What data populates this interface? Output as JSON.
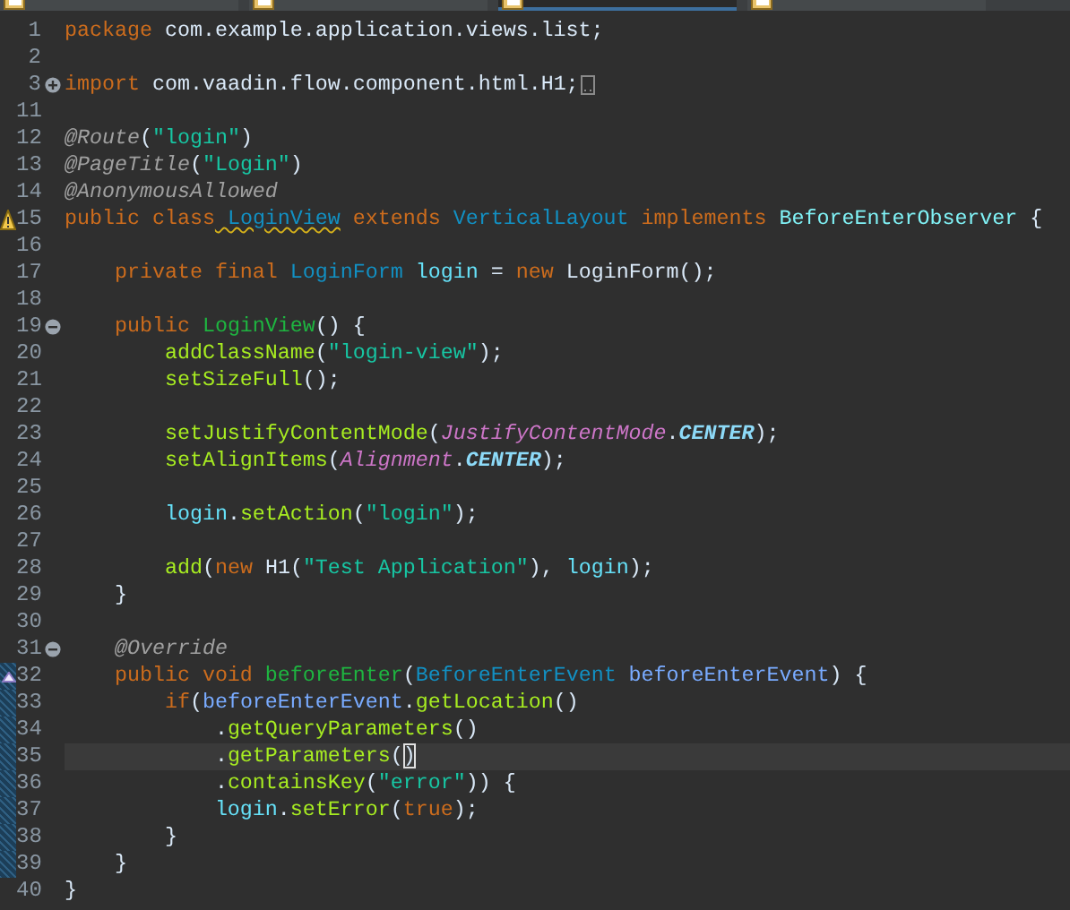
{
  "tabs": [
    {
      "selected": false
    },
    {
      "selected": false
    },
    {
      "selected": true
    },
    {
      "selected": false
    }
  ],
  "editor": {
    "lines": [
      {
        "number": "1",
        "changed": false,
        "current": false,
        "tokens": [
          {
            "kind": "keyword",
            "text": "package"
          },
          {
            "kind": "plain",
            "text": " com.example.application.views.list;"
          }
        ]
      },
      {
        "number": "2",
        "changed": false,
        "current": false
      },
      {
        "number": "3",
        "fold": {
          "expanded": false
        },
        "folded": true,
        "changed": false,
        "current": false,
        "tokens": [
          {
            "kind": "keyword",
            "text": "import"
          },
          {
            "kind": "plain",
            "text": " com.vaadin.flow.component.html.H1;"
          }
        ]
      },
      {
        "number": "11",
        "changed": false,
        "current": false
      },
      {
        "number": "12",
        "changed": false,
        "current": false,
        "tokens": [
          {
            "kind": "annotation",
            "text": "@Route"
          },
          {
            "kind": "plain",
            "text": "("
          },
          {
            "kind": "string",
            "text": "\"login\""
          },
          {
            "kind": "plain",
            "text": ")"
          }
        ]
      },
      {
        "number": "13",
        "changed": false,
        "current": false,
        "tokens": [
          {
            "kind": "annotation",
            "text": "@PageTitle"
          },
          {
            "kind": "plain",
            "text": "("
          },
          {
            "kind": "string",
            "text": "\"Login\""
          },
          {
            "kind": "plain",
            "text": ")"
          }
        ]
      },
      {
        "number": "14",
        "changed": false,
        "current": false,
        "tokens": [
          {
            "kind": "annotation",
            "text": "@AnonymousAllowed"
          }
        ]
      },
      {
        "number": "15",
        "marker": {
          "kind": "warning"
        },
        "changed": false,
        "current": false,
        "tokens": [
          {
            "kind": "keyword",
            "text": "public class"
          },
          {
            "kind": "type",
            "text": " LoginView",
            "warning": true
          },
          {
            "kind": "keyword",
            "text": " extends"
          },
          {
            "kind": "type",
            "text": " VerticalLayout"
          },
          {
            "kind": "keyword",
            "text": " implements"
          },
          {
            "kind": "interface",
            "text": " BeforeEnterObserver"
          },
          {
            "kind": "plain",
            "text": " {"
          }
        ]
      },
      {
        "number": "16",
        "changed": false,
        "current": false
      },
      {
        "number": "17",
        "changed": false,
        "current": false,
        "tokens": [
          {
            "kind": "keyword",
            "text": "    private final"
          },
          {
            "kind": "type",
            "text": " LoginForm"
          },
          {
            "kind": "field",
            "text": " login"
          },
          {
            "kind": "plain",
            "text": " ="
          },
          {
            "kind": "keyword",
            "text": " new"
          },
          {
            "kind": "plain",
            "text": " LoginForm();"
          }
        ]
      },
      {
        "number": "18",
        "changed": false,
        "current": false
      },
      {
        "number": "19",
        "fold": {
          "expanded": true
        },
        "changed": false,
        "current": false,
        "tokens": [
          {
            "kind": "keyword",
            "text": "    public"
          },
          {
            "kind": "declaration",
            "text": " LoginView"
          },
          {
            "kind": "plain",
            "text": "() {"
          }
        ]
      },
      {
        "number": "20",
        "changed": false,
        "current": false,
        "tokens": [
          {
            "kind": "method",
            "text": "        addClassName"
          },
          {
            "kind": "plain",
            "text": "("
          },
          {
            "kind": "string",
            "text": "\"login-view\""
          },
          {
            "kind": "plain",
            "text": ");"
          }
        ]
      },
      {
        "number": "21",
        "changed": false,
        "current": false,
        "tokens": [
          {
            "kind": "method",
            "text": "        setSizeFull"
          },
          {
            "kind": "plain",
            "text": "();"
          }
        ]
      },
      {
        "number": "22",
        "changed": false,
        "current": false
      },
      {
        "number": "23",
        "changed": false,
        "current": false,
        "tokens": [
          {
            "kind": "method",
            "text": "        setJustifyContentMode"
          },
          {
            "kind": "plain",
            "text": "("
          },
          {
            "kind": "enum",
            "text": "JustifyContentMode"
          },
          {
            "kind": "plain",
            "text": "."
          },
          {
            "kind": "constant",
            "text": "CENTER"
          },
          {
            "kind": "plain",
            "text": ");"
          }
        ]
      },
      {
        "number": "24",
        "changed": false,
        "current": false,
        "tokens": [
          {
            "kind": "method",
            "text": "        setAlignItems"
          },
          {
            "kind": "plain",
            "text": "("
          },
          {
            "kind": "enum",
            "text": "Alignment"
          },
          {
            "kind": "plain",
            "text": "."
          },
          {
            "kind": "constant",
            "text": "CENTER"
          },
          {
            "kind": "plain",
            "text": ");"
          }
        ]
      },
      {
        "number": "25",
        "changed": false,
        "current": false
      },
      {
        "number": "26",
        "changed": false,
        "current": false,
        "tokens": [
          {
            "kind": "field",
            "text": "        login"
          },
          {
            "kind": "plain",
            "text": "."
          },
          {
            "kind": "method",
            "text": "setAction"
          },
          {
            "kind": "plain",
            "text": "("
          },
          {
            "kind": "string",
            "text": "\"login\""
          },
          {
            "kind": "plain",
            "text": ");"
          }
        ]
      },
      {
        "number": "27",
        "changed": false,
        "current": false
      },
      {
        "number": "28",
        "changed": false,
        "current": false,
        "tokens": [
          {
            "kind": "method",
            "text": "        add"
          },
          {
            "kind": "plain",
            "text": "("
          },
          {
            "kind": "keyword",
            "text": "new"
          },
          {
            "kind": "plain",
            "text": " H1("
          },
          {
            "kind": "string",
            "text": "\"Test Application\""
          },
          {
            "kind": "plain",
            "text": "),"
          },
          {
            "kind": "field",
            "text": " login"
          },
          {
            "kind": "plain",
            "text": ");"
          }
        ]
      },
      {
        "number": "29",
        "changed": false,
        "current": false,
        "tokens": [
          {
            "kind": "plain",
            "text": "    }"
          }
        ]
      },
      {
        "number": "30",
        "changed": false,
        "current": false
      },
      {
        "number": "31",
        "fold": {
          "expanded": true
        },
        "changed": false,
        "current": false,
        "tokens": [
          {
            "kind": "annotation",
            "text": "    @Override"
          }
        ]
      },
      {
        "number": "32",
        "marker": {
          "kind": "override"
        },
        "changed": true,
        "current": false,
        "tokens": [
          {
            "kind": "keyword",
            "text": "    public void"
          },
          {
            "kind": "declaration",
            "text": " beforeEnter"
          },
          {
            "kind": "plain",
            "text": "("
          },
          {
            "kind": "type",
            "text": "BeforeEnterEvent"
          },
          {
            "kind": "parameter",
            "text": " beforeEnterEvent"
          },
          {
            "kind": "plain",
            "text": ") {"
          }
        ]
      },
      {
        "number": "33",
        "changed": true,
        "current": false,
        "tokens": [
          {
            "kind": "keyword",
            "text": "        if"
          },
          {
            "kind": "plain",
            "text": "("
          },
          {
            "kind": "parameter",
            "text": "beforeEnterEvent"
          },
          {
            "kind": "plain",
            "text": "."
          },
          {
            "kind": "method",
            "text": "getLocation"
          },
          {
            "kind": "plain",
            "text": "()"
          }
        ]
      },
      {
        "number": "34",
        "changed": true,
        "current": false,
        "tokens": [
          {
            "kind": "plain",
            "text": "            ."
          },
          {
            "kind": "method",
            "text": "getQueryParameters"
          },
          {
            "kind": "plain",
            "text": "()"
          }
        ]
      },
      {
        "number": "35",
        "changed": true,
        "current": true,
        "tokens": [
          {
            "kind": "plain",
            "text": "            ."
          },
          {
            "kind": "method",
            "text": "getParameters"
          },
          {
            "kind": "plain",
            "text": "("
          },
          {
            "kind": "matched-bracket",
            "text": ")"
          }
        ]
      },
      {
        "number": "36",
        "changed": true,
        "current": false,
        "tokens": [
          {
            "kind": "plain",
            "text": "            ."
          },
          {
            "kind": "method",
            "text": "containsKey"
          },
          {
            "kind": "plain",
            "text": "("
          },
          {
            "kind": "string",
            "text": "\"error\""
          },
          {
            "kind": "plain",
            "text": ")) {"
          }
        ]
      },
      {
        "number": "37",
        "changed": true,
        "current": false,
        "tokens": [
          {
            "kind": "field",
            "text": "            login"
          },
          {
            "kind": "plain",
            "text": "."
          },
          {
            "kind": "method",
            "text": "setError"
          },
          {
            "kind": "plain",
            "text": "("
          },
          {
            "kind": "keyword",
            "text": "true"
          },
          {
            "kind": "plain",
            "text": ");"
          }
        ]
      },
      {
        "number": "38",
        "changed": true,
        "current": false,
        "tokens": [
          {
            "kind": "plain",
            "text": "        }"
          }
        ]
      },
      {
        "number": "39",
        "changed": true,
        "current": false,
        "tokens": [
          {
            "kind": "plain",
            "text": "    }"
          }
        ]
      },
      {
        "number": "40",
        "changed": false,
        "current": false,
        "tokens": [
          {
            "kind": "plain",
            "text": "}"
          }
        ]
      }
    ]
  }
}
